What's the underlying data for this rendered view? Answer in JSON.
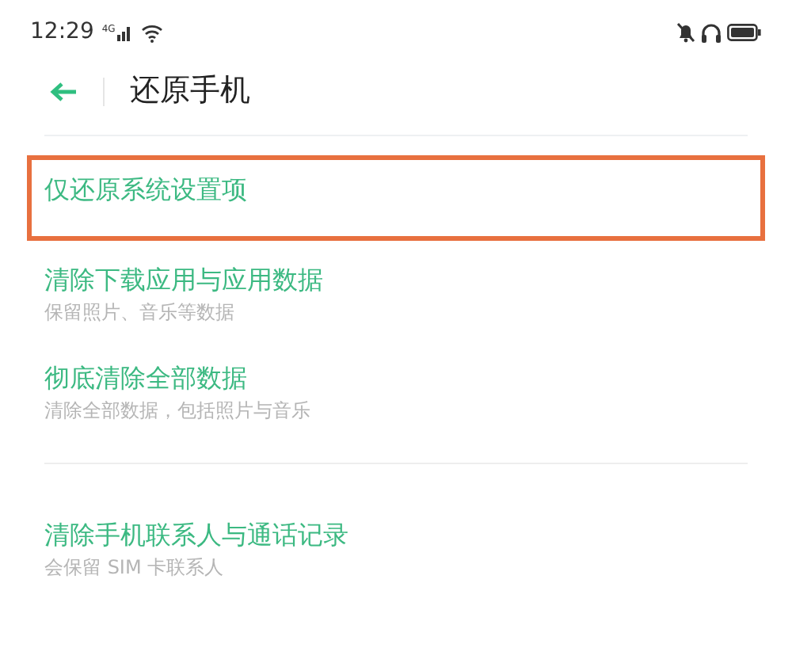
{
  "status_bar": {
    "time": "12:29",
    "network": "4G"
  },
  "header": {
    "title": "还原手机"
  },
  "groups": [
    {
      "items": [
        {
          "title": "仅还原系统设置项",
          "highlighted": true
        },
        {
          "title": "清除下载应用与应用数据",
          "subtitle": "保留照片、音乐等数据",
          "highlighted": false
        },
        {
          "title": "彻底清除全部数据",
          "subtitle": "清除全部数据，包括照片与音乐",
          "highlighted": false
        }
      ]
    },
    {
      "items": [
        {
          "title": "清除手机联系人与通话记录",
          "subtitle": "会保留 SIM 卡联系人",
          "highlighted": false
        }
      ]
    }
  ]
}
